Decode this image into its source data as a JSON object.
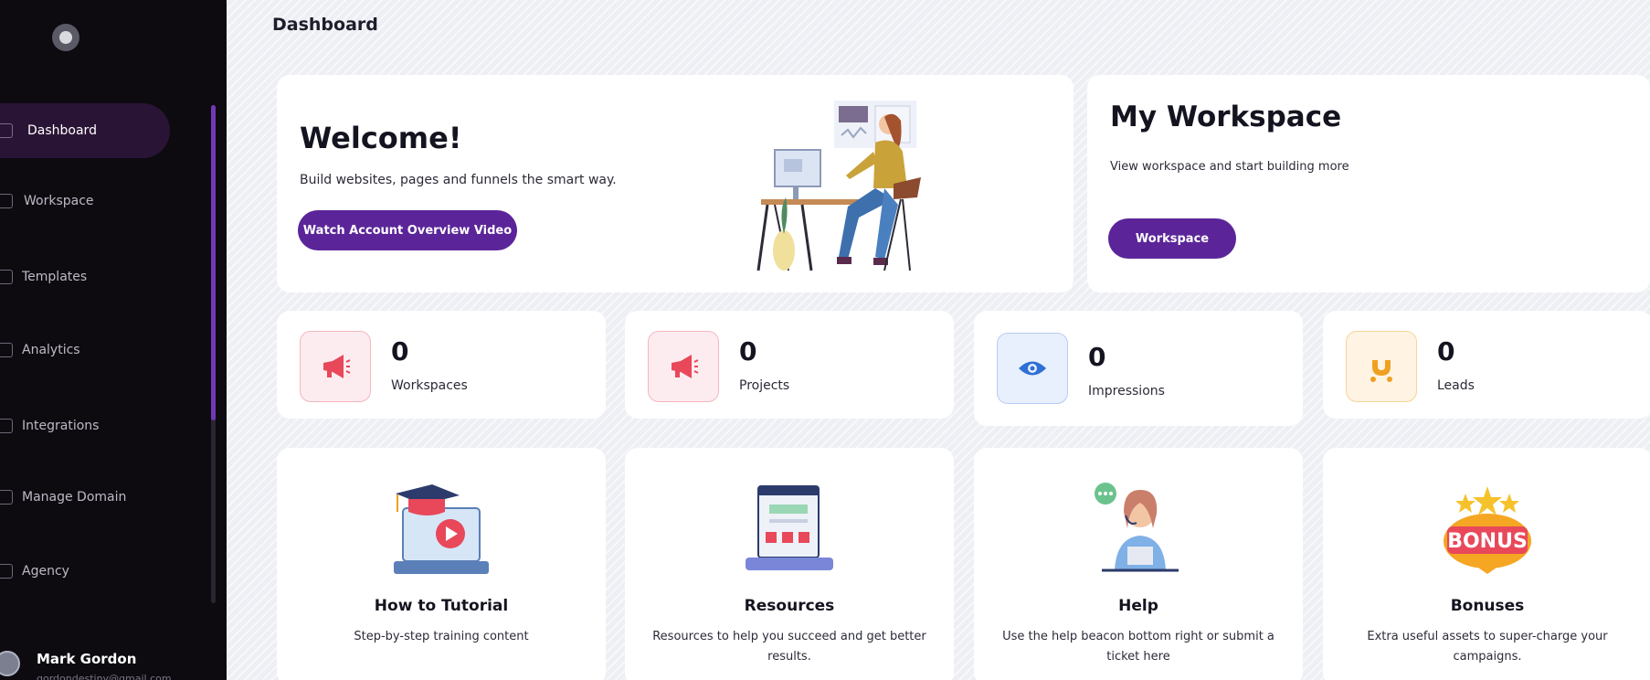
{
  "sidebar": {
    "logo_icon": "app-logo-icon",
    "items": [
      {
        "label": "Dashboard",
        "icon": "dashboard-icon",
        "active": true
      },
      {
        "label": "Workspace",
        "icon": "workspace-icon"
      },
      {
        "label": "Templates",
        "icon": "templates-icon"
      },
      {
        "label": "Analytics",
        "icon": "analytics-icon"
      },
      {
        "label": "Integrations",
        "icon": "integrations-icon"
      },
      {
        "label": "Manage Domain",
        "icon": "domain-icon"
      },
      {
        "label": "Agency",
        "icon": "agency-icon"
      }
    ],
    "user": {
      "name": "Mark Gordon",
      "email": "gordondestiny@gmail.com"
    }
  },
  "header": {
    "title": "Dashboard"
  },
  "welcome": {
    "title": "Welcome!",
    "subtitle": "Build websites, pages and funnels the smart way.",
    "button": "Watch Account Overview Video"
  },
  "workspace": {
    "title": "My Workspace",
    "description": "View workspace and start building more",
    "button": "Workspace"
  },
  "stats": [
    {
      "value": "0",
      "label": "Workspaces",
      "icon": "megaphone-icon",
      "color": "#e8485a",
      "bg": "#fdecef"
    },
    {
      "value": "0",
      "label": "Projects",
      "icon": "megaphone-icon",
      "color": "#e8485a",
      "bg": "#fdecef"
    },
    {
      "value": "0",
      "label": "Impressions",
      "icon": "eye-icon",
      "color": "#2f6fd6",
      "bg": "#e9f0fd"
    },
    {
      "value": "0",
      "label": "Leads",
      "icon": "magnet-icon",
      "color": "#f0a021",
      "bg": "#fff4e3"
    }
  ],
  "features": [
    {
      "title": "How to Tutorial",
      "description": "Step-by-step training content",
      "icon": "tutorial-icon"
    },
    {
      "title": "Resources",
      "description": "Resources to help you succeed and get better results.",
      "icon": "resources-icon"
    },
    {
      "title": "Help",
      "description": "Use the help beacon bottom right or submit a ticket here",
      "icon": "help-icon"
    },
    {
      "title": "Bonuses",
      "description": "Extra useful assets to super-charge your campaigns.",
      "icon": "bonus-icon",
      "badge_text": "BONUS"
    }
  ],
  "colors": {
    "accent": "#5b2599",
    "sidebar_bg": "#0d0b10",
    "active_nav": "#2a1436"
  }
}
